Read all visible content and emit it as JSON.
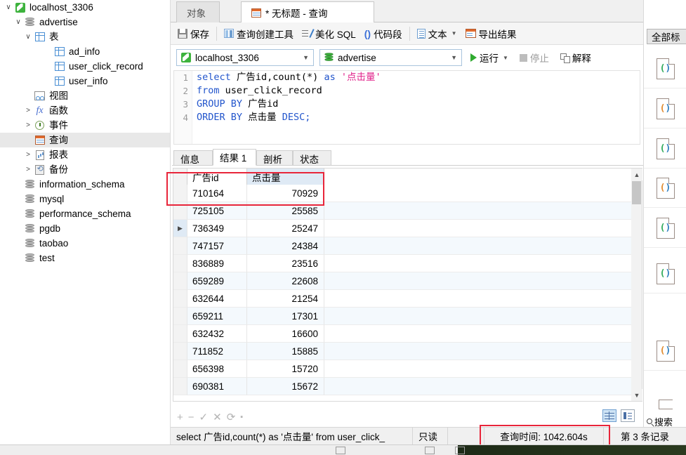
{
  "sidebar": {
    "items": [
      {
        "label": "localhost_3306",
        "icon": "connection-icon",
        "indent": 0,
        "twisty": "v",
        "selected": false
      },
      {
        "label": "advertise",
        "icon": "database-icon",
        "indent": 1,
        "twisty": "v",
        "selected": false
      },
      {
        "label": "表",
        "icon": "table-folder-icon",
        "indent": 2,
        "twisty": "v",
        "selected": false
      },
      {
        "label": "ad_info",
        "icon": "table-icon",
        "indent": 4,
        "twisty": "",
        "selected": false
      },
      {
        "label": "user_click_record",
        "icon": "table-icon",
        "indent": 4,
        "twisty": "",
        "selected": false
      },
      {
        "label": "user_info",
        "icon": "table-icon",
        "indent": 4,
        "twisty": "",
        "selected": false
      },
      {
        "label": "视图",
        "icon": "view-icon",
        "indent": 2,
        "twisty": "",
        "selected": false
      },
      {
        "label": "函数",
        "icon": "function-icon",
        "indent": 2,
        "twisty": ">",
        "selected": false
      },
      {
        "label": "事件",
        "icon": "event-icon",
        "indent": 2,
        "twisty": ">",
        "selected": false
      },
      {
        "label": "查询",
        "icon": "query-icon",
        "indent": 2,
        "twisty": "",
        "selected": true
      },
      {
        "label": "报表",
        "icon": "report-icon",
        "indent": 2,
        "twisty": ">",
        "selected": false
      },
      {
        "label": "备份",
        "icon": "backup-icon",
        "indent": 2,
        "twisty": ">",
        "selected": false
      },
      {
        "label": "information_schema",
        "icon": "database-icon",
        "indent": 1,
        "twisty": "",
        "selected": false
      },
      {
        "label": "mysql",
        "icon": "database-icon",
        "indent": 1,
        "twisty": "",
        "selected": false
      },
      {
        "label": "performance_schema",
        "icon": "database-icon",
        "indent": 1,
        "twisty": "",
        "selected": false
      },
      {
        "label": "pgdb",
        "icon": "database-icon",
        "indent": 1,
        "twisty": "",
        "selected": false
      },
      {
        "label": "taobao",
        "icon": "database-icon",
        "indent": 1,
        "twisty": "",
        "selected": false
      },
      {
        "label": "test",
        "icon": "database-icon",
        "indent": 1,
        "twisty": "",
        "selected": false
      }
    ]
  },
  "window_tabs": [
    {
      "label": "对象",
      "active": false
    },
    {
      "label": "* 无标题 - 查询",
      "active": true
    }
  ],
  "toolbar": {
    "save": "保存",
    "query_builder": "查询创建工具",
    "beautify_sql": "美化 SQL",
    "snippet": "代码段",
    "text": "文本",
    "export_result": "导出结果"
  },
  "connbar": {
    "connection": "localhost_3306",
    "database": "advertise",
    "run": "运行",
    "stop": "停止",
    "explain": "解释"
  },
  "editor": {
    "lines": [
      {
        "num": "1",
        "tokens": [
          {
            "t": "select ",
            "c": "kw"
          },
          {
            "t": "广告id,count(*) ",
            "c": "pl"
          },
          {
            "t": "as ",
            "c": "kw"
          },
          {
            "t": "'点击量'",
            "c": "str"
          }
        ]
      },
      {
        "num": "2",
        "tokens": [
          {
            "t": "from ",
            "c": "kw"
          },
          {
            "t": "user_click_record",
            "c": "pl"
          }
        ]
      },
      {
        "num": "3",
        "tokens": [
          {
            "t": "GROUP BY ",
            "c": "kw"
          },
          {
            "t": "广告id",
            "c": "pl"
          }
        ]
      },
      {
        "num": "4",
        "tokens": [
          {
            "t": "ORDER BY ",
            "c": "kw"
          },
          {
            "t": "点击量 ",
            "c": "pl"
          },
          {
            "t": "DESC;",
            "c": "kw"
          }
        ]
      }
    ]
  },
  "result_tabs": [
    {
      "label": "信息",
      "active": false
    },
    {
      "label": "结果 1",
      "active": true
    },
    {
      "label": "剖析",
      "active": false
    },
    {
      "label": "状态",
      "active": false
    }
  ],
  "grid": {
    "columns": [
      "广告id",
      "点击量"
    ],
    "rows": [
      {
        "id": "710164",
        "count": "70929",
        "current": false
      },
      {
        "id": "725105",
        "count": "25585",
        "current": false
      },
      {
        "id": "736349",
        "count": "25247",
        "current": true
      },
      {
        "id": "747157",
        "count": "24384",
        "current": false
      },
      {
        "id": "836889",
        "count": "23516",
        "current": false
      },
      {
        "id": "659289",
        "count": "22608",
        "current": false
      },
      {
        "id": "632644",
        "count": "21254",
        "current": false
      },
      {
        "id": "659211",
        "count": "17301",
        "current": false
      },
      {
        "id": "632432",
        "count": "16600",
        "current": false
      },
      {
        "id": "711852",
        "count": "15885",
        "current": false
      },
      {
        "id": "656398",
        "count": "15720",
        "current": false
      },
      {
        "id": "690381",
        "count": "15672",
        "current": false
      }
    ],
    "footer_buttons": [
      "+",
      "−",
      "✓",
      "✕",
      "⟳",
      "▪"
    ]
  },
  "statusbar": {
    "sql": "select 广告id,count(*) as '点击量' from user_click_",
    "readonly": "只读",
    "query_time": "查询时间: 1042.604s",
    "record": "第 3 条记录"
  },
  "right_panel": {
    "all_button": "全部标",
    "search": "搜索",
    "items": [
      {
        "icon": "code-doc-icon",
        "color": "green"
      },
      {
        "icon": "code-doc-icon",
        "color": "orange"
      },
      {
        "icon": "code-doc-icon",
        "color": "green"
      },
      {
        "icon": "code-doc-icon",
        "color": "orange"
      },
      {
        "icon": "code-doc-icon",
        "color": "green"
      },
      {
        "icon": "code-doc-icon",
        "color": "green"
      },
      {
        "icon": "code-doc-icon",
        "color": "orange"
      }
    ]
  },
  "colors": {
    "accent": "#2255cc",
    "string": "#e0218a",
    "annotation": "#e8253a",
    "run_green": "#2faa2f",
    "header_highlight": "#dfeaf5"
  }
}
